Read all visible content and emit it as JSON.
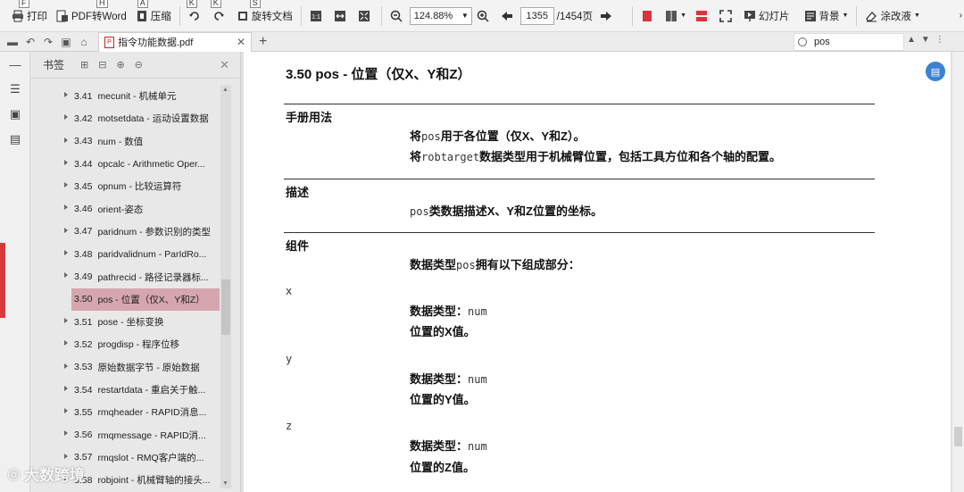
{
  "toolbar": {
    "print": "打印",
    "print_key": "F",
    "pdf2word": "PDF转Word",
    "pdf2word_key": "H",
    "compress": "压缩",
    "compress_key": "A",
    "rotate_left_key": "K",
    "rotate_right_key": "K",
    "rotate_doc": "旋转文档",
    "rotate_doc_key": "S",
    "zoom": "124.88%",
    "page_current": "1355",
    "page_total": "/1454页",
    "slideshow": "幻灯片",
    "background": "背景",
    "annotate": "涂改液"
  },
  "tabbar": {
    "doc_tab": "指令功能数据.pdf",
    "search_value": "pos"
  },
  "bookmarks": {
    "title": "书签",
    "items": [
      {
        "num": "3.41",
        "label": "mecunit - 机械单元"
      },
      {
        "num": "3.42",
        "label": "motsetdata - 运动设置数据"
      },
      {
        "num": "3.43",
        "label": "num - 数值"
      },
      {
        "num": "3.44",
        "label": "opcalc - Arithmetic Oper..."
      },
      {
        "num": "3.45",
        "label": "opnum - 比较运算符"
      },
      {
        "num": "3.46",
        "label": "orient-姿态"
      },
      {
        "num": "3.47",
        "label": "paridnum - 参数识别的类型"
      },
      {
        "num": "3.48",
        "label": "paridvalidnum - ParIdRo..."
      },
      {
        "num": "3.49",
        "label": "pathrecid - 路径记录器标..."
      },
      {
        "num": "3.50",
        "label": "pos - 位置（仅X、Y和Z）"
      },
      {
        "num": "3.51",
        "label": "pose - 坐标变换"
      },
      {
        "num": "3.52",
        "label": "progdisp - 程序位移"
      },
      {
        "num": "3.53",
        "label": "原始数据字节 - 原始数据"
      },
      {
        "num": "3.54",
        "label": "restartdata - 重启关于触..."
      },
      {
        "num": "3.55",
        "label": "rmqheader - RAPID消息..."
      },
      {
        "num": "3.56",
        "label": "rmqmessage - RAPID消..."
      },
      {
        "num": "3.57",
        "label": "rmqslot - RMQ客户端的..."
      },
      {
        "num": "3.58",
        "label": "robjoint - 机械臂轴的接头..."
      }
    ]
  },
  "document": {
    "title": "3.50  pos - 位置（仅X、Y和Z）",
    "usage_label": "手册用法",
    "usage_line1_a": "将",
    "usage_line1_code": "pos",
    "usage_line1_b": "用于各位置（仅X、Y和Z）。",
    "usage_line2_a": "将",
    "usage_line2_code": "robtarget",
    "usage_line2_b": "数据类型用于机械臂位置，包括工具方位和各个轴的配置。",
    "desc_label": "描述",
    "desc_code": "pos",
    "desc_text": "类数据描述X、Y和Z位置的坐标。",
    "comp_label": "组件",
    "comp_a": "数据类型",
    "comp_code": "pos",
    "comp_b": "拥有以下组成部分：",
    "x_name": "x",
    "y_name": "y",
    "z_name": "z",
    "type_prefix": "数据类型：",
    "type_num": "num",
    "x_desc": "位置的X值。",
    "y_desc": "位置的Y值。",
    "z_desc": "位置的Z值。"
  },
  "watermark": "大数跨境"
}
